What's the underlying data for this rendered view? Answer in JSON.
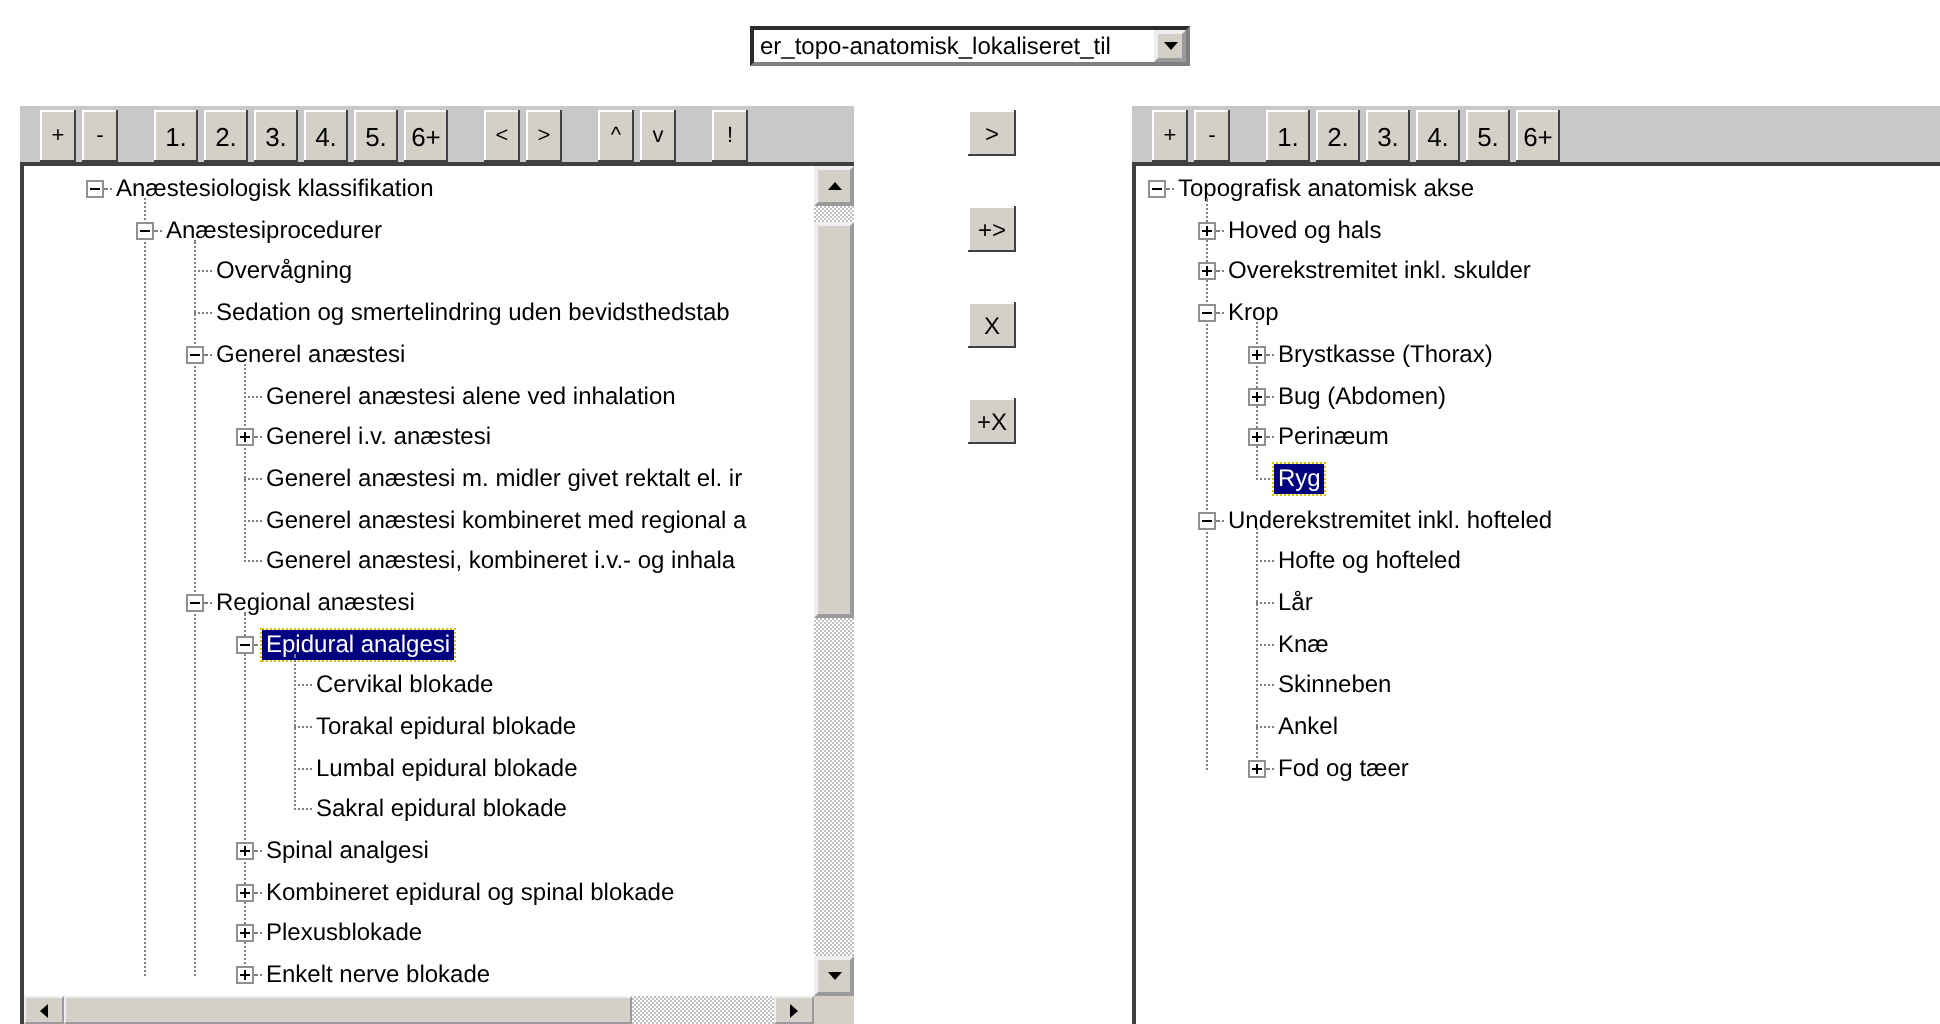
{
  "relation_dropdown": {
    "value": "er_topo-anatomisk_lokaliseret_til"
  },
  "left_panel": {
    "toolbar": [
      [
        "+",
        "-"
      ],
      [
        "1.",
        "2.",
        "3.",
        "4.",
        "5.",
        "6+"
      ],
      [
        "<",
        ">"
      ],
      [
        "^",
        "v"
      ],
      [
        "!"
      ]
    ],
    "tree": [
      {
        "label": "Anæstesiologisk klassifikation",
        "expanded": true,
        "selected": false,
        "children": [
          {
            "label": "Anæstesiprocedurer",
            "expanded": true,
            "selected": false,
            "children": [
              {
                "label": "Overvågning",
                "selected": false
              },
              {
                "label": "Sedation og smertelindring uden bevidsthedstab",
                "selected": false
              },
              {
                "label": "Generel anæstesi",
                "expanded": true,
                "selected": false,
                "children": [
                  {
                    "label": "Generel anæstesi alene ved inhalation",
                    "selected": false
                  },
                  {
                    "label": "Generel i.v. anæstesi",
                    "expanded": false,
                    "selected": false
                  },
                  {
                    "label": "Generel anæstesi m. midler givet rektalt el. ir",
                    "selected": false
                  },
                  {
                    "label": "Generel anæstesi kombineret med regional a",
                    "selected": false
                  },
                  {
                    "label": "Generel anæstesi, kombineret i.v.- og inhala",
                    "selected": false
                  }
                ]
              },
              {
                "label": "Regional anæstesi",
                "expanded": true,
                "selected": false,
                "children": [
                  {
                    "label": "Epidural analgesi",
                    "expanded": true,
                    "selected": true,
                    "children": [
                      {
                        "label": "Cervikal blokade",
                        "selected": false
                      },
                      {
                        "label": "Torakal epidural blokade",
                        "selected": false
                      },
                      {
                        "label": "Lumbal epidural blokade",
                        "selected": false
                      },
                      {
                        "label": "Sakral epidural blokade",
                        "selected": false
                      }
                    ]
                  },
                  {
                    "label": "Spinal analgesi",
                    "expanded": false,
                    "selected": false
                  },
                  {
                    "label": "Kombineret epidural og spinal blokade",
                    "expanded": false,
                    "selected": false
                  },
                  {
                    "label": "Plexusblokade",
                    "expanded": false,
                    "selected": false
                  },
                  {
                    "label": "Enkelt nerve blokade",
                    "expanded": false,
                    "selected": false
                  }
                ]
              }
            ]
          }
        ]
      }
    ]
  },
  "transfer_buttons": [
    ">",
    "+>",
    "X",
    "+X"
  ],
  "right_panel": {
    "toolbar": [
      [
        "+",
        "-"
      ],
      [
        "1.",
        "2.",
        "3.",
        "4.",
        "5.",
        "6+"
      ]
    ],
    "tree": [
      {
        "label": "Topografisk anatomisk akse",
        "expanded": true,
        "selected": false,
        "children": [
          {
            "label": "Hoved og hals",
            "expanded": false,
            "selected": false
          },
          {
            "label": "Overekstremitet inkl. skulder",
            "expanded": false,
            "selected": false
          },
          {
            "label": "Krop",
            "expanded": true,
            "selected": false,
            "children": [
              {
                "label": "Brystkasse (Thorax)",
                "expanded": false,
                "selected": false
              },
              {
                "label": "Bug (Abdomen)",
                "expanded": false,
                "selected": false
              },
              {
                "label": "Perinæum",
                "expanded": false,
                "selected": false
              },
              {
                "label": "Ryg",
                "selected": true
              }
            ]
          },
          {
            "label": "Underekstremitet inkl. hofteled",
            "expanded": true,
            "selected": false,
            "children": [
              {
                "label": "Hofte og hofteled",
                "selected": false
              },
              {
                "label": "Lår",
                "selected": false
              },
              {
                "label": "Knæ",
                "selected": false
              },
              {
                "label": "Skinneben",
                "selected": false
              },
              {
                "label": "Ankel",
                "selected": false
              },
              {
                "label": "Fod og tæer",
                "expanded": false,
                "selected": false
              }
            ]
          }
        ]
      }
    ]
  }
}
